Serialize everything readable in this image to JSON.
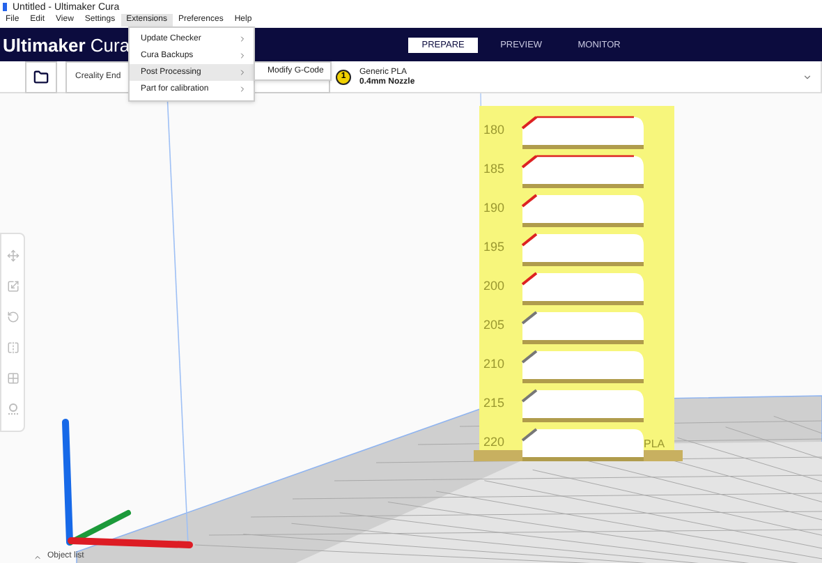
{
  "window": {
    "title": "Untitled - Ultimaker Cura"
  },
  "menu_bar": [
    {
      "label": "File",
      "selected": false
    },
    {
      "label": "Edit",
      "selected": false
    },
    {
      "label": "View",
      "selected": false
    },
    {
      "label": "Settings",
      "selected": false
    },
    {
      "label": "Extensions",
      "selected": true
    },
    {
      "label": "Preferences",
      "selected": false
    },
    {
      "label": "Help",
      "selected": false
    }
  ],
  "extensions_menu": [
    {
      "label": "Update Checker",
      "selected": false
    },
    {
      "label": "Cura Backups",
      "selected": false
    },
    {
      "label": "Post Processing",
      "selected": true
    },
    {
      "label": "Part for calibration",
      "selected": false
    }
  ],
  "submenu": [
    {
      "label": "Modify G-Code"
    }
  ],
  "header": {
    "brand": "Ultimaker",
    "product": "Cura",
    "stages": [
      {
        "label": "PREPARE",
        "selected": true
      },
      {
        "label": "PREVIEW",
        "selected": false
      },
      {
        "label": "MONITOR",
        "selected": false
      }
    ]
  },
  "toolbar": {
    "printer": "Creality End",
    "extruder_number": "1",
    "material": "Generic PLA",
    "nozzle": "0.4mm Nozzle"
  },
  "model_labels": [
    "180",
    "185",
    "190",
    "195",
    "200",
    "205",
    "210",
    "215",
    "220"
  ],
  "model_tag": "PLA",
  "object_list": {
    "label": "Object list",
    "expanded": false
  }
}
